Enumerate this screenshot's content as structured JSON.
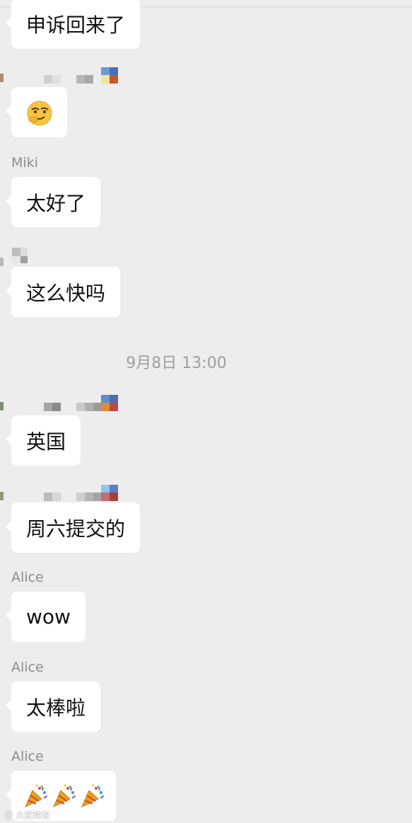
{
  "colors": {
    "background": "#ededed",
    "bubble": "#ffffff",
    "text": "#111111",
    "sender_name": "#8c8c8c",
    "timestamp": "#9e9e9e"
  },
  "chat": {
    "messages": [
      {
        "text": "申诉回来了"
      },
      {
        "emoji_icon": "smirking-face-icon"
      },
      {
        "sender": "Miki",
        "text": "太好了"
      },
      {
        "text": "这么快吗"
      },
      {
        "text": "英国"
      },
      {
        "text": "周六提交的"
      },
      {
        "sender": "Alice",
        "text": "wow"
      },
      {
        "sender": "Alice",
        "text": "太棒啦"
      },
      {
        "sender": "Alice",
        "emoji_icon": "party-popper-icon",
        "emoji_count": 3
      }
    ],
    "timestamp": "9月8日 13:00"
  },
  "watermark": "大武辣说"
}
